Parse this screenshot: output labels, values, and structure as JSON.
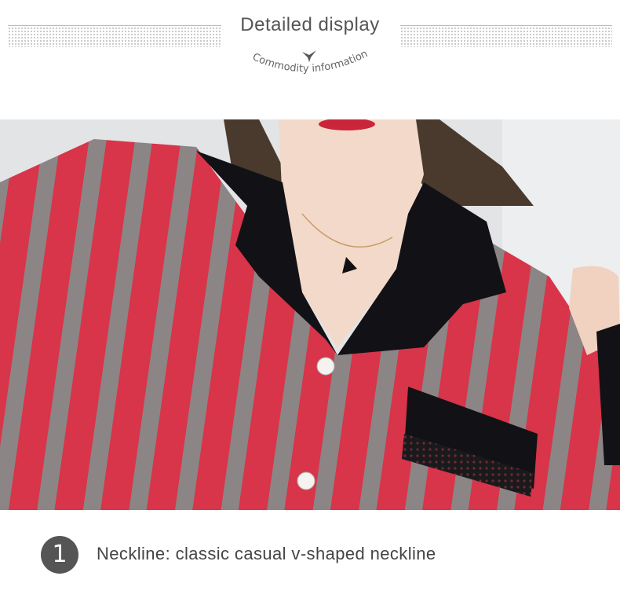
{
  "header": {
    "title": "Detailed display",
    "subtitle": "Commodity information"
  },
  "photo": {
    "description_icon": "product-photo"
  },
  "feature": {
    "number": "1",
    "text": "Neckline: classic casual v-shaped neckline"
  },
  "colors": {
    "stripe_red": "#d8344a",
    "stripe_gray": "#8c8585",
    "collar_black": "#121216",
    "badge": "#555555"
  }
}
